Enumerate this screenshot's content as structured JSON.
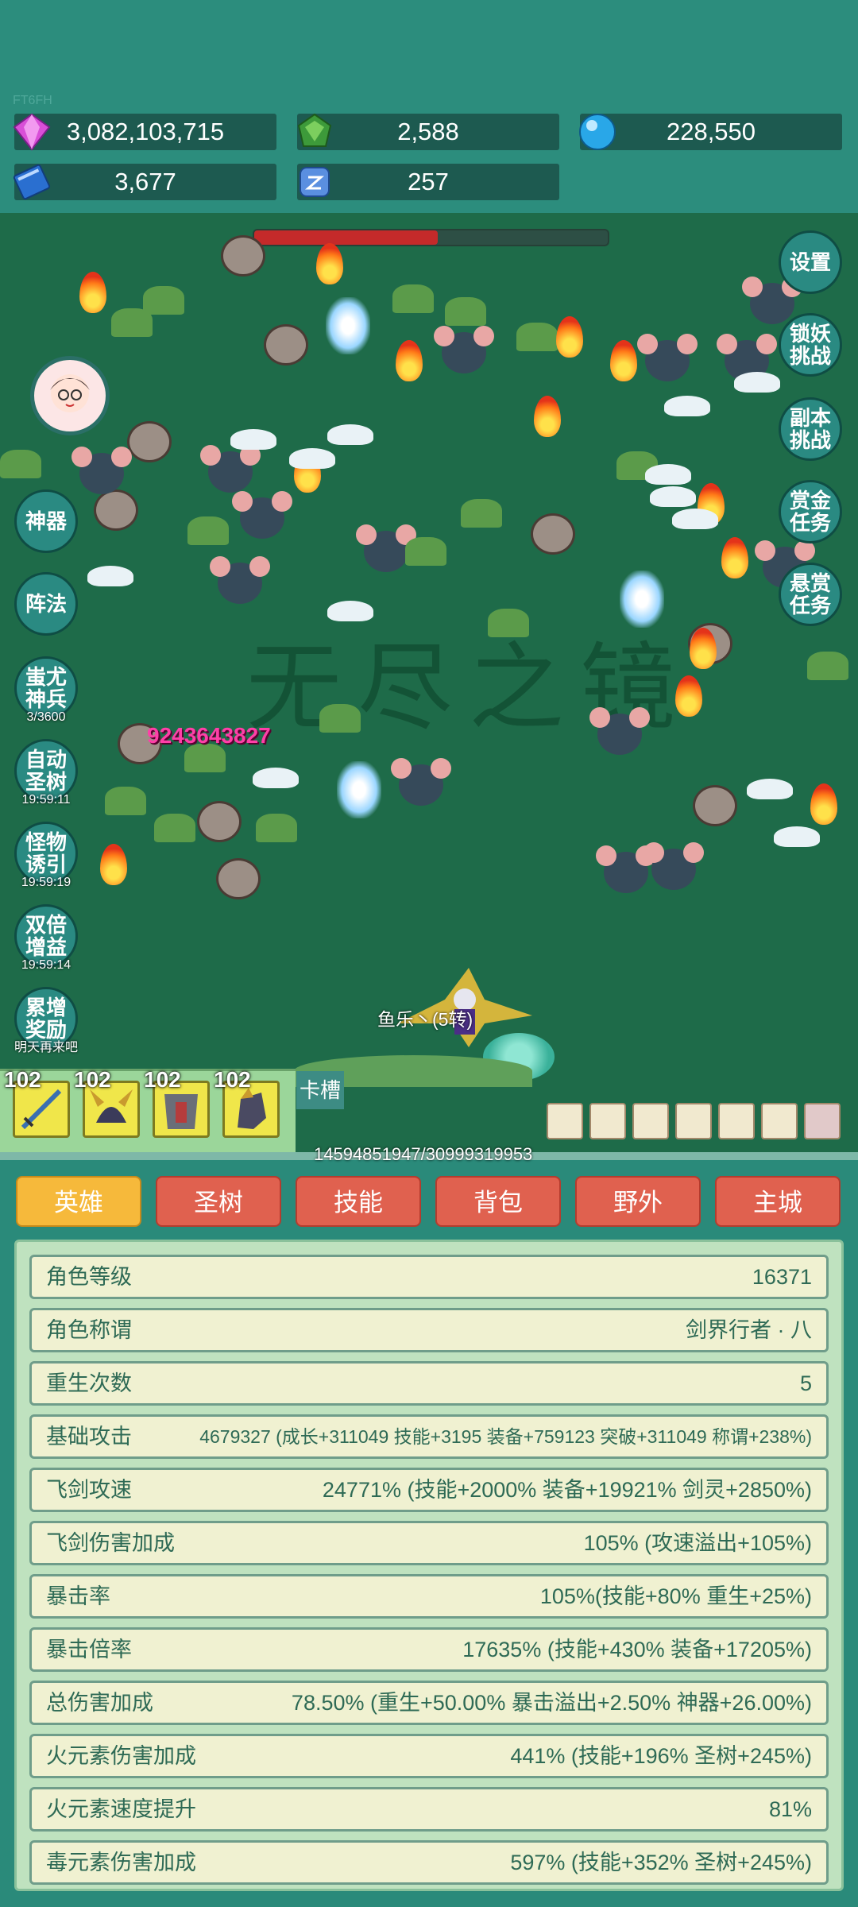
{
  "top": {
    "tag": "FT6FH",
    "resources": [
      {
        "icon": "pink-gem-icon",
        "value": "3,082,103,715",
        "color": "#d94fd8"
      },
      {
        "icon": "green-gem-icon",
        "value": "2,588",
        "color": "#3d9a3a"
      },
      {
        "icon": "blue-orb-icon",
        "value": "228,550",
        "color": "#29a7e8"
      },
      {
        "icon": "blue-book-icon",
        "value": "3,677",
        "color": "#2a6fd0"
      },
      {
        "icon": "rune-stone-icon",
        "value": "257",
        "color": "#5a8fe0"
      }
    ]
  },
  "battle": {
    "boss_hp_fraction": 0.52,
    "watermark": "无尽之镜",
    "damage_text": "9243643827",
    "player_name": "鱼乐丶(5转)",
    "hp_text": "14594851947/30999319953"
  },
  "left_buttons": [
    {
      "label": "神器",
      "sub": ""
    },
    {
      "label": "阵法",
      "sub": ""
    },
    {
      "label": "蚩尤神兵",
      "sub": "3/3600"
    },
    {
      "label": "自动圣树",
      "sub": "19:59:11"
    },
    {
      "label": "怪物诱引",
      "sub": "19:59:19"
    },
    {
      "label": "双倍增益",
      "sub": "19:59:14"
    },
    {
      "label": "累增奖励",
      "sub": "明天再来吧"
    }
  ],
  "right_buttons": [
    "设置",
    "锁妖挑战",
    "副本挑战",
    "赏金任务",
    "悬赏任务"
  ],
  "skills": [
    {
      "level": "102",
      "icon": "sword-icon"
    },
    {
      "level": "102",
      "icon": "horned-helmet-icon"
    },
    {
      "level": "102",
      "icon": "armor-icon"
    },
    {
      "level": "102",
      "icon": "gauntlet-icon"
    }
  ],
  "card_slot_label": "卡槽",
  "tabs": [
    "英雄",
    "圣树",
    "技能",
    "背包",
    "野外",
    "主城"
  ],
  "active_tab": 0,
  "stats": [
    {
      "label": "角色等级",
      "value": "16371"
    },
    {
      "label": "角色称谓",
      "value": "剑界行者 · 八"
    },
    {
      "label": "重生次数",
      "value": "5"
    },
    {
      "label": "基础攻击",
      "value": "4679327 (成长+311049 技能+3195 装备+759123 突破+311049 称谓+238%)"
    },
    {
      "label": "飞剑攻速",
      "value": "24771% (技能+2000% 装备+19921% 剑灵+2850%)"
    },
    {
      "label": "飞剑伤害加成",
      "value": "105% (攻速溢出+105%)"
    },
    {
      "label": "暴击率",
      "value": "105%(技能+80% 重生+25%)"
    },
    {
      "label": "暴击倍率",
      "value": "17635% (技能+430% 装备+17205%)"
    },
    {
      "label": "总伤害加成",
      "value": "78.50% (重生+50.00% 暴击溢出+2.50% 神器+26.00%)"
    },
    {
      "label": "火元素伤害加成",
      "value": "441% (技能+196% 圣树+245%)"
    },
    {
      "label": "火元素速度提升",
      "value": "81%"
    },
    {
      "label": "毒元素伤害加成",
      "value": "597% (技能+352% 圣树+245%)"
    }
  ]
}
